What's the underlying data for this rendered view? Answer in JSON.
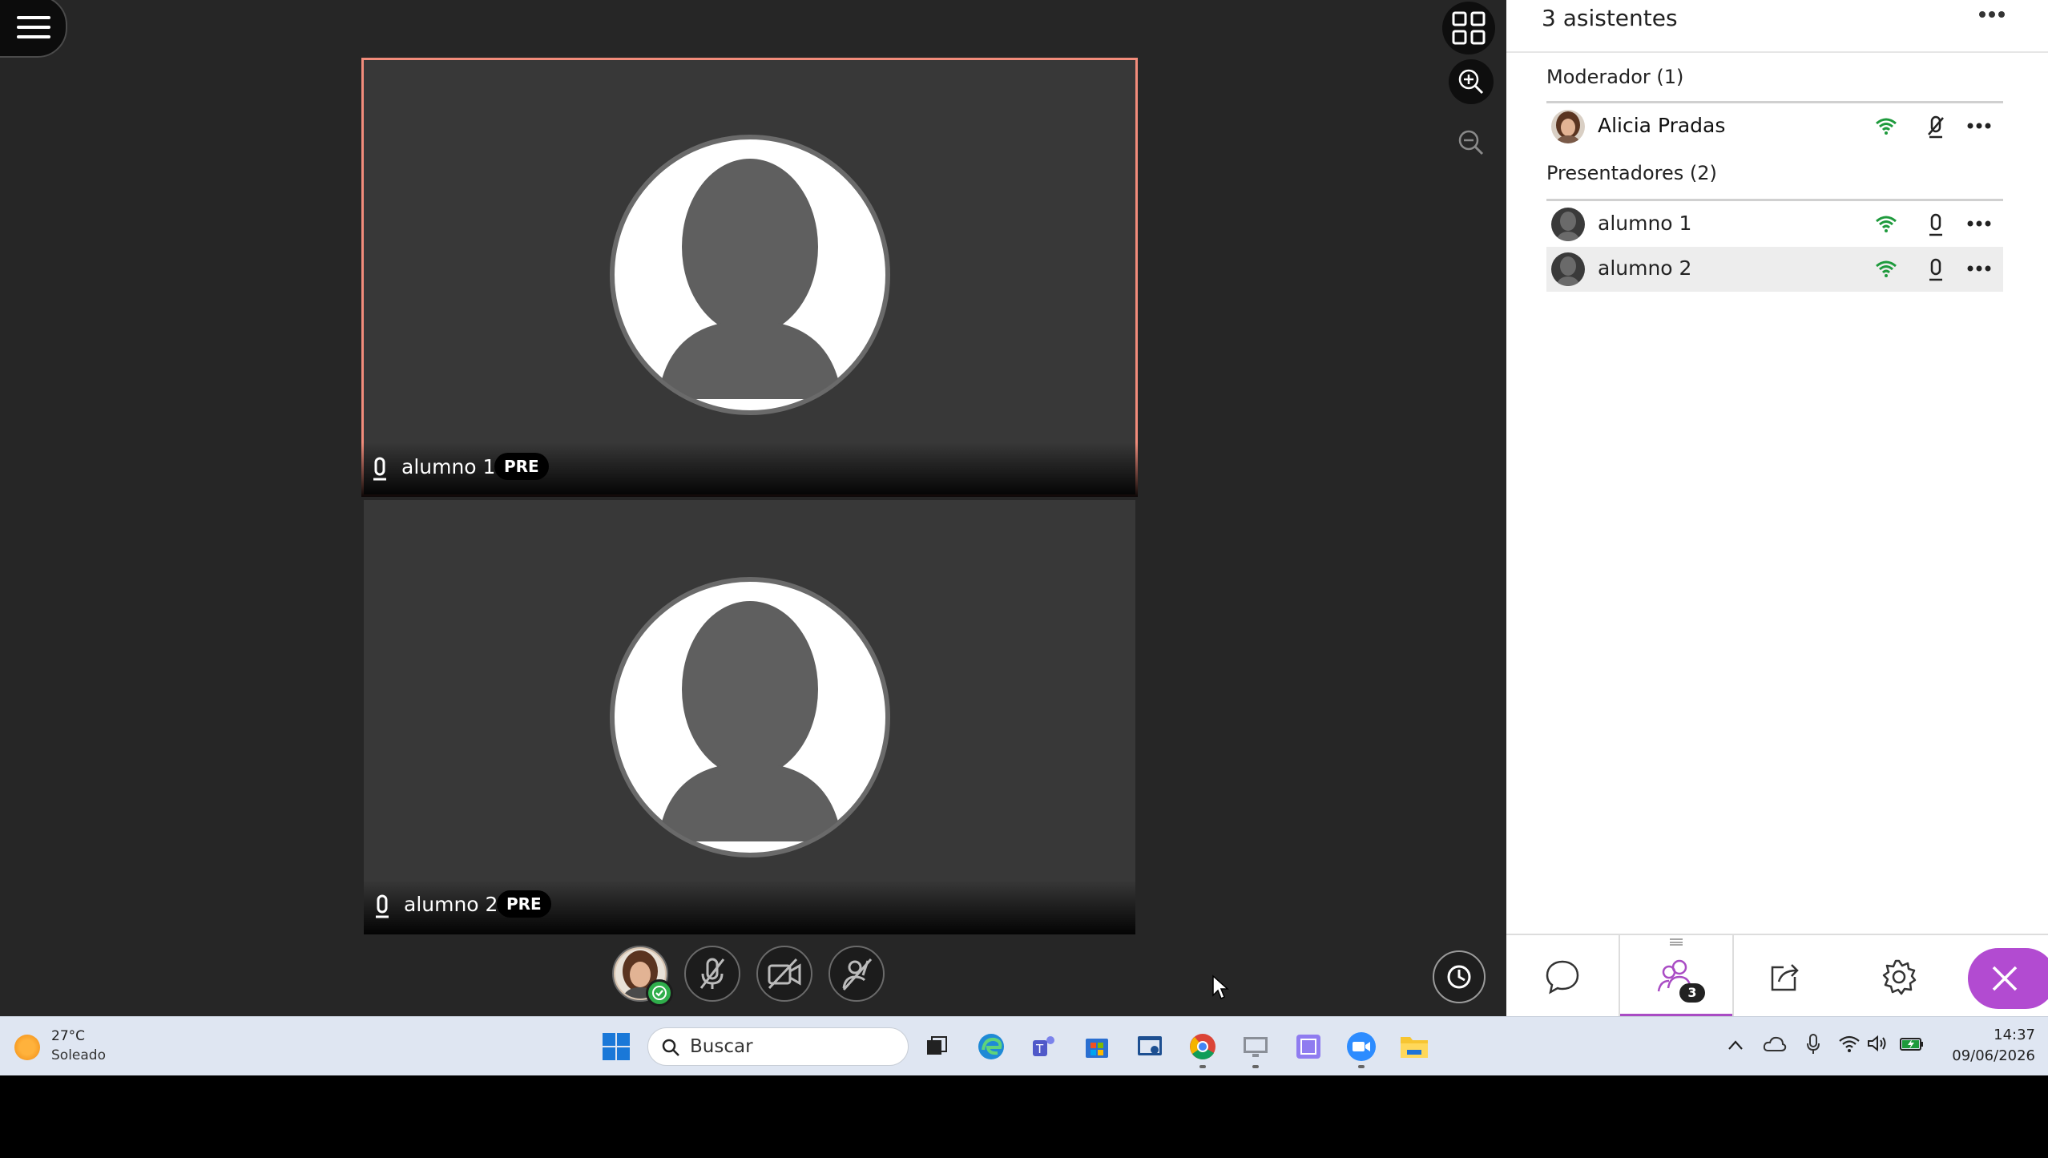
{
  "panel": {
    "title": "3 asistentes",
    "tab_badge_count": "3",
    "sections": [
      {
        "label": "Moderador (1)",
        "participants": [
          {
            "name": "Alicia Pradas",
            "mic": "muted",
            "connection": "good"
          }
        ]
      },
      {
        "label": "Presentadores (2)",
        "participants": [
          {
            "name": "alumno 1",
            "mic": "on",
            "connection": "good"
          },
          {
            "name": "alumno 2",
            "mic": "on",
            "connection": "good"
          }
        ]
      }
    ]
  },
  "videos": [
    {
      "name": "alumno 1",
      "badge": "PRE",
      "active": true
    },
    {
      "name": "alumno 2",
      "badge": "PRE",
      "active": false
    }
  ],
  "taskbar": {
    "weather_temp": "27°C",
    "weather_desc": "Soleado",
    "search_placeholder": "Buscar",
    "time": "14:37",
    "date": "09/06/2026"
  },
  "colors": {
    "accent": "#a94cc4",
    "active_border": "#f28c7b",
    "status_green": "#1e9a3c",
    "close_button": "#b24bd1"
  },
  "icons": {
    "menu": "hamburger-icon",
    "layout": "grid-view-icon",
    "zoom_in": "zoom-in-icon",
    "zoom_out": "zoom-out-icon",
    "timer": "clock-icon",
    "chat": "chat-icon",
    "attendees": "people-icon",
    "share": "share-icon",
    "settings": "gear-icon",
    "close": "close-icon"
  }
}
